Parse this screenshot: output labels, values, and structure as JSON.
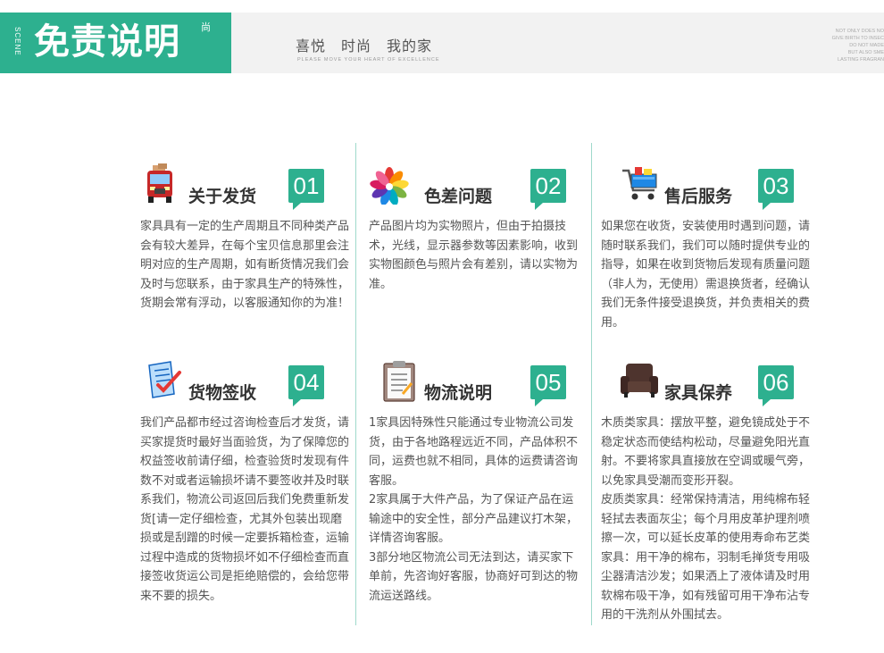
{
  "header": {
    "scene_label": "SCENE",
    "title": "免责说明",
    "title_badge": "尚",
    "slogan": "喜悦　时尚　我的家",
    "slogan_sub": "PLEASE MOVE YOUR HEART OF EXCELLENCE",
    "corner_lines": [
      "NOT ONLY DOES NO",
      "GIVE BIRTH TO INSEC",
      "DO NOT MADE",
      "BUT ALSO SME",
      "LASTING FRAGRAN"
    ]
  },
  "sections": [
    {
      "icon": "truck-icon",
      "title": "关于发货",
      "number": "01",
      "paragraphs": [
        "家具具有一定的生产周期且不同种类产品会有较大差异，在每个宝贝信息那里会注明对应的生产周期，如有断货情况我们会及时与您联系，由于家具生产的特殊性，货期会常有浮动，以客服通知你的为准！"
      ]
    },
    {
      "icon": "color-palette-icon",
      "title": "色差问题",
      "number": "02",
      "paragraphs": [
        "产品图片均为实物照片，但由于拍摄技术，光线，显示器参数等因素影响，收到实物图颜色与照片会有差别，请以实物为准。"
      ]
    },
    {
      "icon": "shopping-cart-icon",
      "title": "售后服务",
      "number": "03",
      "paragraphs": [
        "如果您在收货，安装使用时遇到问题，请随时联系我们，我们可以随时提供专业的指导，如果在收到货物后发现有质量问题（非人为，无使用）需退换货者，经确认我们无条件接受退换货，并负责相关的费用。"
      ]
    },
    {
      "icon": "checklist-icon",
      "title": "货物签收",
      "number": "04",
      "paragraphs": [
        "我们产品都市经过咨询检查后才发货，请买家提货时最好当面验货，为了保障您的权益签收前请仔细，检查验货时发现有件数不对或者运输损坏请不要签收并及时联系我们，物流公司返回后我们免费重新发货[请一定仔细检查，尤其外包装出现磨损或是刮蹭的时候一定要拆箱检查，运输过程中造成的货物损坏如不仔细检查而直接签收货运公司是拒绝赔偿的，会给您带来不要的损失。"
      ]
    },
    {
      "icon": "clipboard-icon",
      "title": "物流说明",
      "number": "05",
      "paragraphs": [
        "1家具因特殊性只能通过专业物流公司发货，由于各地路程远近不同，产品体积不同，运费也就不相同，具体的运费请咨询客服。",
        "2家具属于大件产品，为了保证产品在运输途中的安全性，部分产品建议打木架，详情咨询客服。",
        "3部分地区物流公司无法到达，请买家下单前，先咨询好客服，协商好可到达的物流运送路线。"
      ]
    },
    {
      "icon": "armchair-icon",
      "title": "家具保养",
      "number": "06",
      "paragraphs": [
        "木质类家具：摆放平整，避免镜成处于不稳定状态而使结构松动，尽量避免阳光直射。不要将家具直接放在空调或暖气旁，以免家具受潮而变形开裂。",
        "皮质类家具：经常保持清洁，用纯棉布轻轻拭去表面灰尘；每个月用皮革护理剂喷擦一次，可以延长皮革的使用寿命布艺类家具：用干净的棉布，羽制毛掸货专用吸尘器清洁沙发；如果洒上了液体请及时用软棉布吸干净，如有残留可用干净布沾专用的干洗剂从外围拭去。"
      ]
    }
  ]
}
